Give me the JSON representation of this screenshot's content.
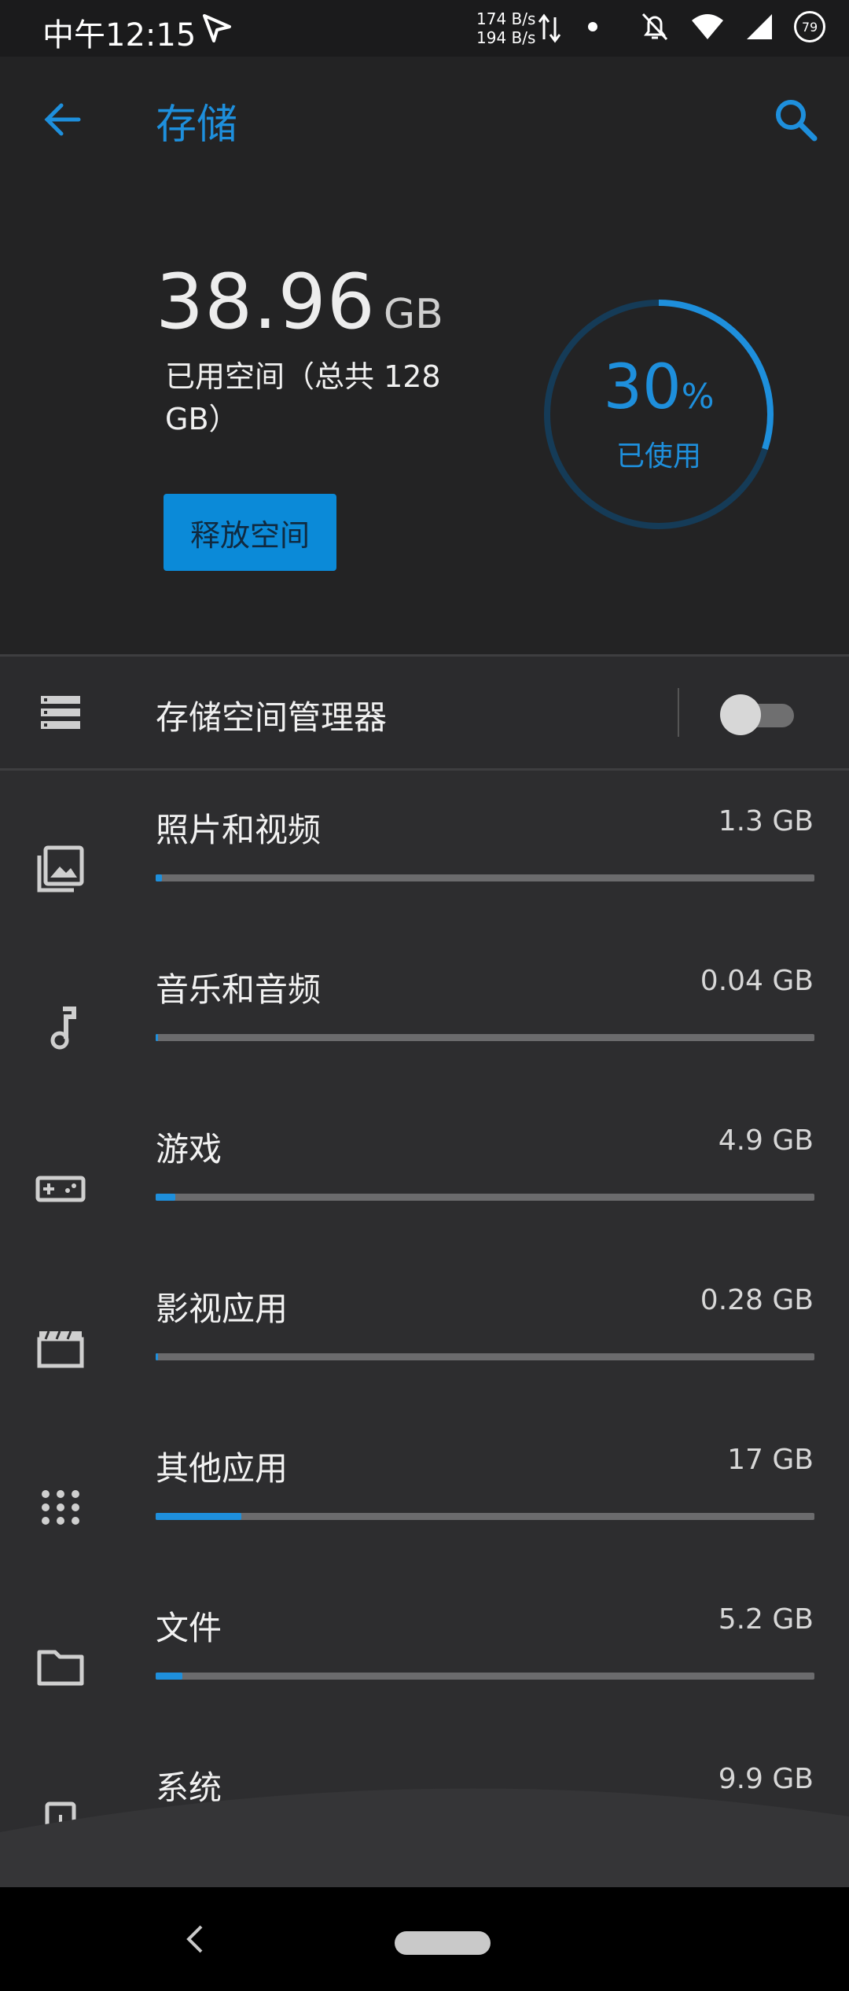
{
  "status_bar": {
    "time": "中午12:15",
    "net_up": "174 B/s",
    "net_down": "194 B/s",
    "battery": "79"
  },
  "header": {
    "title": "存储",
    "used_value": "38.96",
    "used_unit": "GB",
    "used_desc": "已用空间（总共 128 GB）",
    "free_button": "释放空间",
    "percent": "30",
    "percent_sign": "%",
    "percent_label": "已使用",
    "percent_fraction": 0.3
  },
  "manager": {
    "label": "存储空间管理器",
    "enabled": false
  },
  "categories": [
    {
      "name": "照片和视频",
      "size": "1.3 GB",
      "fraction": 0.01,
      "icon": "photo-library-icon"
    },
    {
      "name": "音乐和音频",
      "size": "0.04 GB",
      "fraction": 0.0,
      "icon": "music-note-icon"
    },
    {
      "name": "游戏",
      "size": "4.9 GB",
      "fraction": 0.03,
      "icon": "gamepad-icon"
    },
    {
      "name": "影视应用",
      "size": "0.28 GB",
      "fraction": 0.0,
      "icon": "clapperboard-icon"
    },
    {
      "name": "其他应用",
      "size": "17 GB",
      "fraction": 0.13,
      "icon": "apps-grid-icon"
    },
    {
      "name": "文件",
      "size": "5.2 GB",
      "fraction": 0.04,
      "icon": "folder-icon"
    },
    {
      "name": "系统",
      "size": "9.9 GB",
      "fraction": 0.07,
      "icon": "system-update-icon"
    }
  ],
  "colors": {
    "accent": "#1e8fdc",
    "background": "#2d2d2f",
    "header": "#232324"
  }
}
